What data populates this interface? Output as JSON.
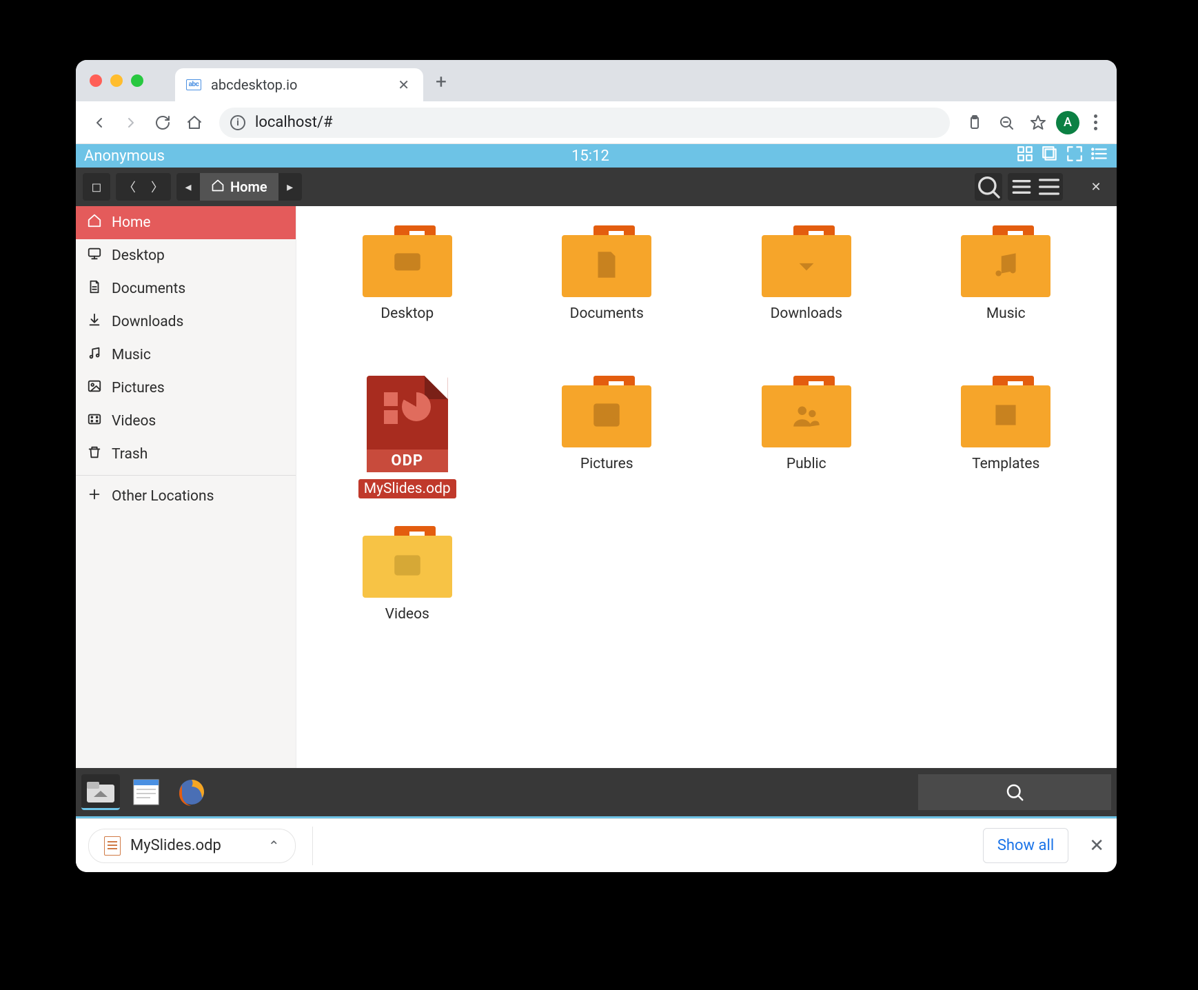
{
  "browser": {
    "tab_title": "abcdesktop.io",
    "url": "localhost/#",
    "avatar_letter": "A"
  },
  "vdesktop": {
    "user": "Anonymous",
    "clock": "15:12"
  },
  "filemanager": {
    "path_label": "Home",
    "toolbar": {
      "search_tip": "Search",
      "list_tip": "List view",
      "menu_tip": "Menu",
      "close_tip": "Close"
    },
    "sidebar": [
      {
        "id": "home",
        "label": "Home",
        "icon": "home",
        "active": true
      },
      {
        "id": "desktop",
        "label": "Desktop",
        "icon": "monitor",
        "active": false
      },
      {
        "id": "documents",
        "label": "Documents",
        "icon": "file",
        "active": false
      },
      {
        "id": "downloads",
        "label": "Downloads",
        "icon": "download",
        "active": false
      },
      {
        "id": "music",
        "label": "Music",
        "icon": "music",
        "active": false
      },
      {
        "id": "pictures",
        "label": "Pictures",
        "icon": "image",
        "active": false
      },
      {
        "id": "videos",
        "label": "Videos",
        "icon": "video",
        "active": false
      },
      {
        "id": "trash",
        "label": "Trash",
        "icon": "trash",
        "active": false
      },
      {
        "id": "other",
        "label": "Other Locations",
        "icon": "plus",
        "active": false
      }
    ],
    "grid": [
      {
        "label": "Desktop",
        "type": "folder",
        "glyph": "monitor",
        "selected": false
      },
      {
        "label": "Documents",
        "type": "folder",
        "glyph": "file",
        "selected": false
      },
      {
        "label": "Downloads",
        "type": "folder",
        "glyph": "download",
        "selected": false
      },
      {
        "label": "Music",
        "type": "folder",
        "glyph": "music",
        "selected": false
      },
      {
        "label": "MySlides.odp",
        "type": "file",
        "glyph": "odp",
        "selected": true
      },
      {
        "label": "Pictures",
        "type": "folder",
        "glyph": "image",
        "selected": false
      },
      {
        "label": "Public",
        "type": "folder",
        "glyph": "people",
        "selected": false
      },
      {
        "label": "Templates",
        "type": "folder",
        "glyph": "template",
        "selected": false
      },
      {
        "label": "Videos",
        "type": "folder",
        "glyph": "video",
        "selected": false,
        "light": true
      }
    ],
    "odp_badge": "ODP"
  },
  "shelf": {
    "download_name": "MySlides.odp",
    "show_all": "Show all"
  }
}
